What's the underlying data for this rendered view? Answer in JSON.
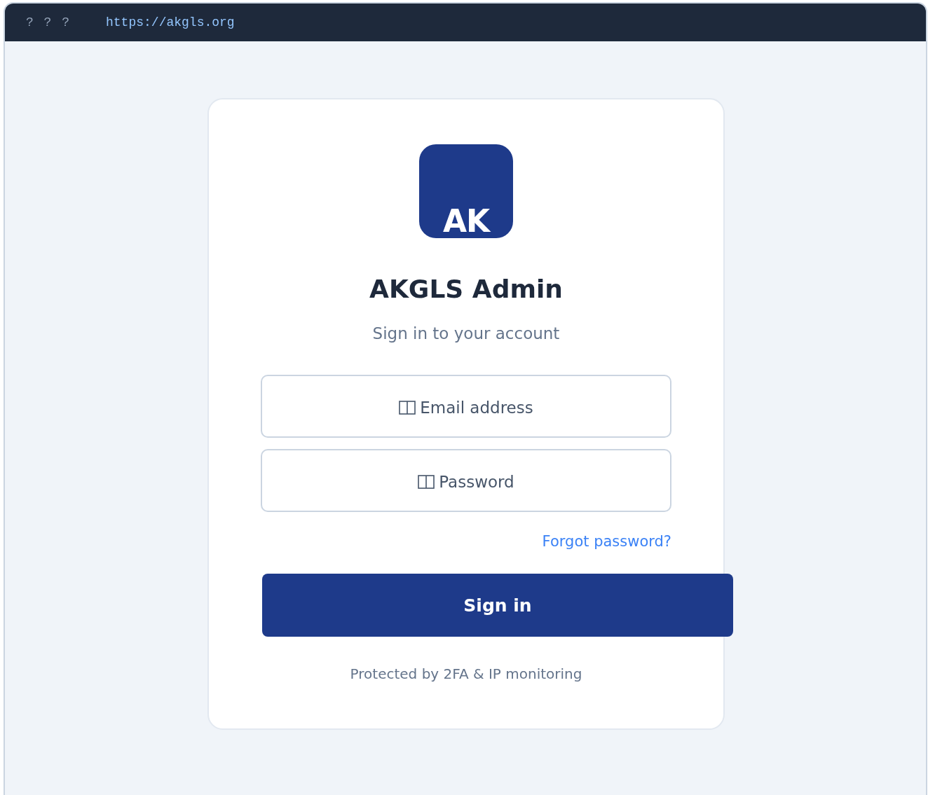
{
  "browser": {
    "controls": "? ? ?",
    "url": "https://akgls.org"
  },
  "logo": {
    "text": "AK"
  },
  "title": "AKGLS Admin",
  "subtitle": "Sign in to your account",
  "fields": [
    {
      "placeholder": "Email address"
    },
    {
      "placeholder": "Password"
    }
  ],
  "forgot_link": "Forgot password?",
  "submit_button": "Sign in",
  "footer_note": "Protected by 2FA & IP monitoring"
}
